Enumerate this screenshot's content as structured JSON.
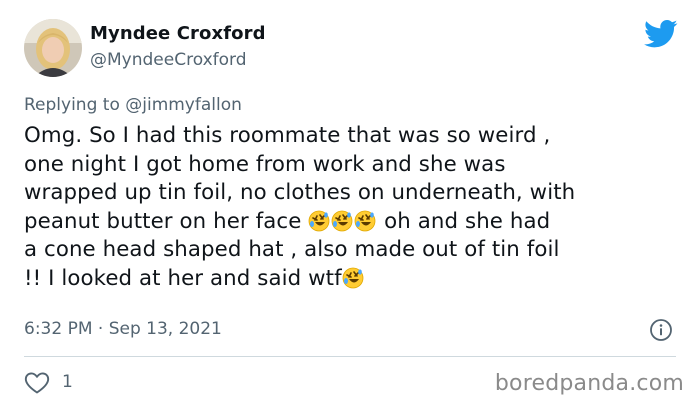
{
  "user": {
    "display_name": "Myndee Croxford",
    "handle": "@MyndeeCroxford",
    "avatar_icon": "avatar-photo"
  },
  "reply": {
    "text": "Replying to @jimmyfallon"
  },
  "tweet": {
    "line1": "Omg. So I had this roommate that was so weird ,",
    "line2": "one night I got home from work and she was",
    "line3": "wrapped up tin foil, no clothes on underneath, with",
    "line4_before": "peanut butter on her face ",
    "line4_after": " oh and she had",
    "line5": "a cone head shaped hat , also made out of tin foil",
    "line6": "!!  I looked at her and said wtf",
    "emoji_name": "rolling-on-floor-laughing"
  },
  "meta": {
    "timestamp": "6:32 PM · Sep 13, 2021"
  },
  "actions": {
    "like_count": "1"
  },
  "watermark": "boredpanda.com",
  "colors": {
    "text": "#0f1419",
    "secondary": "#536471",
    "twitter_blue": "#1d9bf0",
    "divider": "#cfd9de"
  }
}
